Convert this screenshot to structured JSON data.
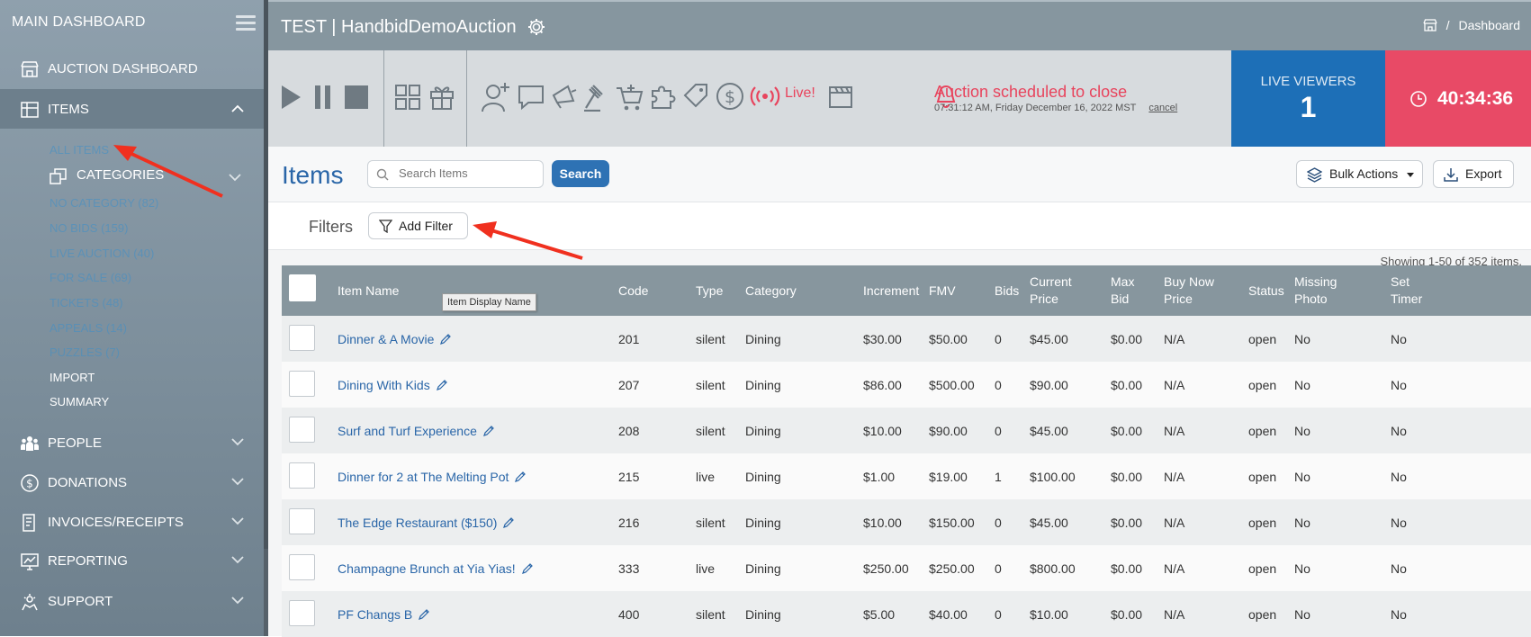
{
  "sidebar": {
    "heading": "MAIN DASHBOARD",
    "nav": [
      {
        "label": "AUCTION DASHBOARD",
        "icon": "storefront-icon"
      },
      {
        "label": "ITEMS",
        "icon": "archive-icon"
      },
      {
        "label": "PEOPLE",
        "icon": "people-icon"
      },
      {
        "label": "DONATIONS",
        "icon": "dollar-circle-icon"
      },
      {
        "label": "INVOICES/RECEIPTS",
        "icon": "receipt-icon"
      },
      {
        "label": "REPORTING",
        "icon": "chart-icon"
      },
      {
        "label": "SUPPORT",
        "icon": "support-icon"
      }
    ],
    "items_sub": {
      "all_items": "ALL ITEMS",
      "categories": "CATEGORIES",
      "category_links": [
        "NO CATEGORY (82)",
        "NO BIDS (159)",
        "LIVE AUCTION (40)",
        "FOR SALE (69)",
        "TICKETS (48)",
        "APPEALS (14)",
        "PUZZLES (7)"
      ],
      "import": "IMPORT",
      "summary": "SUMMARY"
    }
  },
  "header": {
    "title": "TEST | HandbidDemoAuction",
    "breadcrumb": "Dashboard",
    "breadcrumb_sep": "/"
  },
  "toolbar": {
    "live_label": "Live!",
    "alert_title": "Auction scheduled to close",
    "alert_time": "07:31:12 AM, Friday December 16, 2022 MST",
    "cancel": "cancel"
  },
  "live_viewers": {
    "label": "LIVE VIEWERS",
    "count": "1"
  },
  "countdown": "40:34:36",
  "page": {
    "title": "Items",
    "search_placeholder": "Search Items",
    "search_button": "Search",
    "bulk_actions": "Bulk Actions",
    "export": "Export",
    "filters_label": "Filters",
    "add_filter": "Add Filter",
    "showing": "Showing 1-50 of 352 items."
  },
  "table": {
    "headers": {
      "item_name": "Item Name",
      "code": "Code",
      "type": "Type",
      "category": "Category",
      "increment": "Increment",
      "fmv": "FMV",
      "bids": "Bids",
      "current_price_1": "Current",
      "current_price_2": "Price",
      "max_bid_1": "Max",
      "max_bid_2": "Bid",
      "buy_now_1": "Buy Now",
      "buy_now_2": "Price",
      "status": "Status",
      "missing_photo_1": "Missing",
      "missing_photo_2": "Photo",
      "set_timer_1": "Set",
      "set_timer_2": "Timer"
    },
    "tooltip": "Item Display Name",
    "rows": [
      {
        "name": "Dinner & A Movie",
        "code": "201",
        "type": "silent",
        "category": "Dining",
        "increment": "$30.00",
        "fmv": "$50.00",
        "bids": "0",
        "current": "$45.00",
        "max": "$0.00",
        "buynow": "N/A",
        "status": "open",
        "missing": "No",
        "timer": "No"
      },
      {
        "name": "Dining With Kids",
        "code": "207",
        "type": "silent",
        "category": "Dining",
        "increment": "$86.00",
        "fmv": "$500.00",
        "bids": "0",
        "current": "$90.00",
        "max": "$0.00",
        "buynow": "N/A",
        "status": "open",
        "missing": "No",
        "timer": "No"
      },
      {
        "name": "Surf and Turf Experience",
        "code": "208",
        "type": "silent",
        "category": "Dining",
        "increment": "$10.00",
        "fmv": "$90.00",
        "bids": "0",
        "current": "$45.00",
        "max": "$0.00",
        "buynow": "N/A",
        "status": "open",
        "missing": "No",
        "timer": "No"
      },
      {
        "name": "Dinner for 2 at The Melting Pot",
        "code": "215",
        "type": "live",
        "category": "Dining",
        "increment": "$1.00",
        "fmv": "$19.00",
        "bids": "1",
        "current": "$100.00",
        "max": "$0.00",
        "buynow": "N/A",
        "status": "open",
        "missing": "No",
        "timer": "No"
      },
      {
        "name": "The Edge Restaurant ($150)",
        "code": "216",
        "type": "silent",
        "category": "Dining",
        "increment": "$10.00",
        "fmv": "$150.00",
        "bids": "0",
        "current": "$45.00",
        "max": "$0.00",
        "buynow": "N/A",
        "status": "open",
        "missing": "No",
        "timer": "No"
      },
      {
        "name": "Champagne Brunch at Yia Yias!",
        "code": "333",
        "type": "live",
        "category": "Dining",
        "increment": "$250.00",
        "fmv": "$250.00",
        "bids": "0",
        "current": "$800.00",
        "max": "$0.00",
        "buynow": "N/A",
        "status": "open",
        "missing": "No",
        "timer": "No"
      },
      {
        "name": "PF Changs B",
        "code": "400",
        "type": "silent",
        "category": "Dining",
        "increment": "$5.00",
        "fmv": "$40.00",
        "bids": "0",
        "current": "$10.00",
        "max": "$0.00",
        "buynow": "N/A",
        "status": "open",
        "missing": "No",
        "timer": "No"
      }
    ]
  },
  "colors": {
    "accent": "#2a66a8",
    "live_red": "#e8445d",
    "viewers_blue": "#1d6fb7",
    "annotation_arrow": "#f0301f"
  }
}
